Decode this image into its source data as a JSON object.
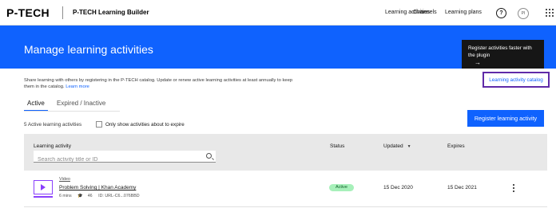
{
  "topnav": {
    "brand": "P-TECH",
    "product": "P-TECH Learning Builder",
    "links": [
      "Learning activities",
      "Channels",
      "Learning plans"
    ],
    "help_icon": "help-icon",
    "avatar_initials": "PI",
    "apps_icon": "apps-grid-icon"
  },
  "banner": {
    "title": "Manage learning activities",
    "promo_text": "Register activities faster with the plugin",
    "promo_arrow": "→",
    "background_color": "#0f62fe"
  },
  "description": {
    "text": "Share learning with others by registering in the P-TECH catalog. Update or renew active learning activities at least annually to keep them in the catalog.",
    "learn_more": "Learn more",
    "catalog_link": "Learning activity catalog"
  },
  "tabs": [
    {
      "label": "Active",
      "selected": true
    },
    {
      "label": "Expired / Inactive",
      "selected": false
    }
  ],
  "filters": {
    "count_label": "5 Active learning activities",
    "checkbox_label": "Only show activities about to expire",
    "checkbox_checked": false,
    "register_button": "Register learning activity"
  },
  "table": {
    "headers": {
      "activity": "Learning activity",
      "status": "Status",
      "updated": "Updated",
      "expires": "Expires"
    },
    "search_placeholder": "Search activity title or ID",
    "rows": [
      {
        "type": "Video",
        "title": "Problem Solving | Khan Academy",
        "duration": "6 mins",
        "learners": "46",
        "id": "ID: URL-C6...076BBD",
        "status": "Active",
        "updated": "15 Dec 2020",
        "expires": "15 Dec 2021"
      }
    ]
  }
}
